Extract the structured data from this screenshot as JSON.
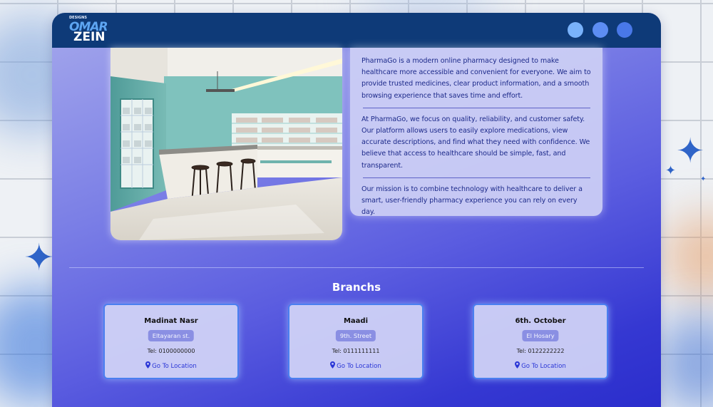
{
  "header": {
    "logo": {
      "top": "DESIGNS",
      "line1": "OMAR",
      "line2": "ZEIN"
    },
    "window_controls": [
      "dot",
      "dot",
      "dot"
    ]
  },
  "about": {
    "image_alt": "Pharmacy interior",
    "paragraphs": [
      "PharmaGo is a modern online pharmacy designed to make healthcare more accessible and convenient for everyone. We aim to provide trusted medicines, clear product information, and a smooth browsing experience that saves time and effort.",
      "At PharmaGo, we focus on quality, reliability, and customer safety. Our platform allows users to easily explore medications, view accurate descriptions, and find what they need with confidence. We believe that access to healthcare should be simple, fast, and transparent.",
      "Our mission is to combine technology with healthcare to deliver a smart, user-friendly pharmacy experience you can rely on every day."
    ]
  },
  "branches": {
    "title": "Branchs",
    "items": [
      {
        "name": "Madinat Nasr",
        "street": "Eltayaran st.",
        "tel": "Tel: 0100000000",
        "link": "Go To Location"
      },
      {
        "name": "Maadi",
        "street": "9th. Street",
        "tel": "Tel: 0111111111",
        "link": "Go To Location"
      },
      {
        "name": "6th. October",
        "street": "El Hosary",
        "tel": "Tel: 0122222222",
        "link": "Go To Location"
      }
    ]
  },
  "colors": {
    "titlebar": "#0e3a78",
    "accent": "#4a7ff0",
    "link": "#2a36d6"
  }
}
